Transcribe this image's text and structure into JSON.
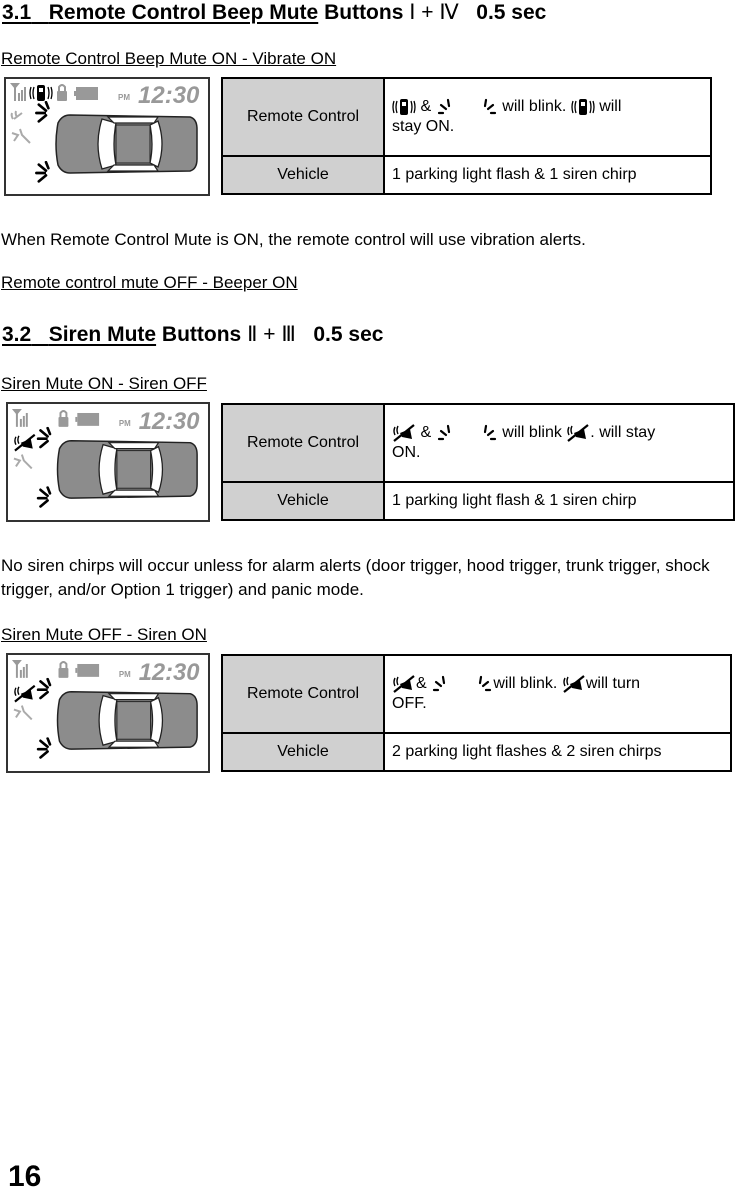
{
  "sections": [
    {
      "number": "3.1",
      "title": "Remote Control Beep Mute",
      "suffix": "Buttons",
      "buttons": "Ⅰ + Ⅳ",
      "duration": "0.5 sec",
      "modes": [
        {
          "heading": "Remote Control Beep Mute ON - Vibrate ON",
          "lcd": {
            "time": "12:30",
            "ampm": "PM",
            "active_icon": "vibrate-icon"
          },
          "rows": {
            "remote_label": "Remote Control",
            "remote_parts": [
              "&",
              "will blink.",
              "will",
              "stay ON."
            ],
            "vehicle_label": "Vehicle",
            "vehicle_text": "1 parking light flash & 1 siren chirp"
          }
        }
      ],
      "note": "When Remote Control Mute is ON, the remote control will use vibration alerts.",
      "alt_heading": "Remote control mute OFF - Beeper ON"
    },
    {
      "number": "3.2",
      "title": "Siren Mute",
      "suffix": "Buttons",
      "buttons": "Ⅱ + Ⅲ",
      "duration": "0.5 sec",
      "modes": [
        {
          "heading": "Siren Mute ON - Siren OFF",
          "lcd": {
            "time": "12:30",
            "ampm": "PM",
            "active_icon": "siren-mute-icon"
          },
          "rows": {
            "remote_label": "Remote Control",
            "remote_parts": [
              "&",
              "will blink",
              ". will stay",
              "ON."
            ],
            "vehicle_label": "Vehicle",
            "vehicle_text": "1 parking light flash & 1 siren chirp"
          }
        },
        {
          "heading": "Siren Mute OFF - Siren ON",
          "lcd": {
            "time": "12:30",
            "ampm": "PM",
            "active_icon": "siren-mute-icon"
          },
          "rows": {
            "remote_label": "Remote Control",
            "remote_parts": [
              "&",
              "will blink.",
              "will turn",
              "OFF."
            ],
            "vehicle_label": "Vehicle",
            "vehicle_text": "2 parking light flashes & 2 siren chirps"
          }
        }
      ],
      "note": "No siren chirps will occur unless for alarm alerts (door trigger, hood trigger, trunk trigger, shock trigger, and/or Option 1 trigger) and panic mode."
    }
  ],
  "page_number": "16"
}
